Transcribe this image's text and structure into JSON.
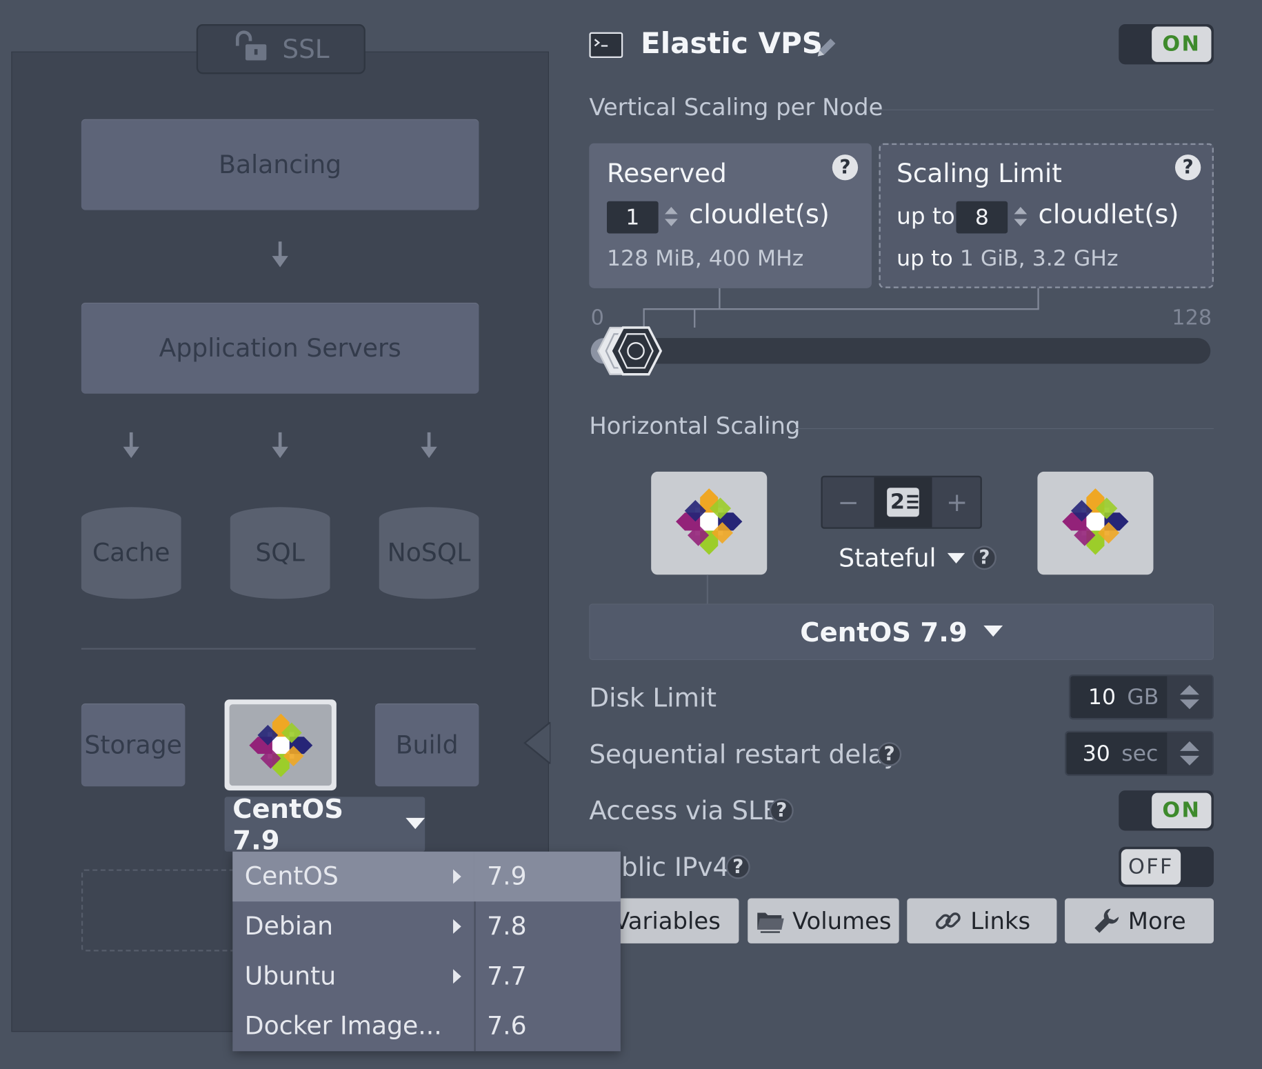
{
  "left": {
    "ssl_label": "SSL",
    "balancing_label": "Balancing",
    "app_servers_label": "Application Servers",
    "cache_label": "Cache",
    "sql_label": "SQL",
    "nosql_label": "NoSQL",
    "storage_label": "Storage",
    "build_label": "Build",
    "selected_node_label": "CentOS 7.9"
  },
  "menu": {
    "os_items": [
      {
        "label": "CentOS",
        "has_submenu": true,
        "selected": true
      },
      {
        "label": "Debian",
        "has_submenu": true
      },
      {
        "label": "Ubuntu",
        "has_submenu": true
      },
      {
        "label": "Docker Image...",
        "has_submenu": false
      }
    ],
    "versions": [
      {
        "label": "7.9",
        "selected": true
      },
      {
        "label": "7.8"
      },
      {
        "label": "7.7"
      },
      {
        "label": "7.6"
      }
    ]
  },
  "header": {
    "title": "Elastic VPS",
    "toggle_label": "ON",
    "toggle_state": true
  },
  "vertical": {
    "title": "Vertical Scaling per Node",
    "reserved": {
      "title": "Reserved",
      "value": "1",
      "unit": "cloudlet(s)",
      "resources": "128 MiB, 400 MHz"
    },
    "limit": {
      "title": "Scaling Limit",
      "prefix": "up to",
      "value": "8",
      "unit": "cloudlet(s)",
      "resources_prefix": "up to",
      "resources": "1 GiB, 3.2 GHz"
    },
    "slider": {
      "min_label": "0",
      "max_label": "128",
      "min": 0,
      "max": 128,
      "reserved": 1,
      "limit": 8
    }
  },
  "horizontal": {
    "title": "Horizontal Scaling",
    "minus": "−",
    "plus": "+",
    "count": "2",
    "mode": "Stateful",
    "os_version": "CentOS 7.9"
  },
  "settings": {
    "disk_limit_label": "Disk Limit",
    "disk_value": "10",
    "disk_unit": "GB",
    "restart_label": "Sequential restart delay",
    "restart_value": "30",
    "restart_unit": "sec",
    "slb_label": "Access via SLB",
    "slb_toggle": "ON",
    "ipv4_label": "blic IPv4",
    "ipv4_toggle": "OFF"
  },
  "tabs": {
    "variables": "Variables",
    "volumes": "Volumes",
    "links": "Links",
    "more": "More"
  },
  "colors": {
    "on_text": "#3e8a2c",
    "background": "#4a5260",
    "left_panel": "#3e4552",
    "menu": "#5e6478",
    "menu_selected": "#858b9d"
  },
  "icons": {
    "ssl": "unlocked-padlock-icon",
    "terminal": "terminal-icon",
    "edit": "pencil-icon",
    "node": "centos-logo-icon",
    "counter": "node-count-icon",
    "volumes": "folder-icon",
    "links": "chain-link-icon",
    "more": "wrench-icon"
  }
}
